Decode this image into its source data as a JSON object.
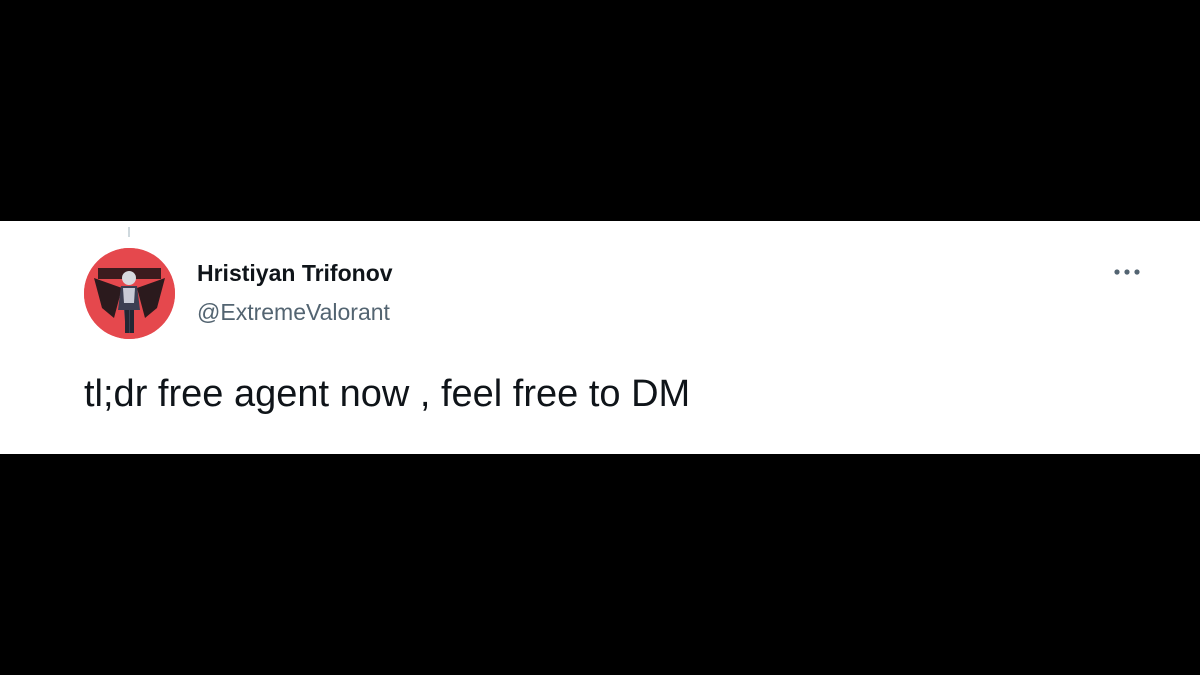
{
  "tweet": {
    "author": {
      "display_name": "Hristiyan Trifonov",
      "handle": "@ExtremeValorant",
      "avatar_icon": "profile-avatar",
      "avatar_bg": "#e5484d"
    },
    "text": "tl;dr free agent now , feel free to DM",
    "more_icon": "more-horizontal-icon"
  },
  "colors": {
    "background": "#000000",
    "card": "#ffffff",
    "primary_text": "#0f1419",
    "secondary_text": "#536471"
  }
}
